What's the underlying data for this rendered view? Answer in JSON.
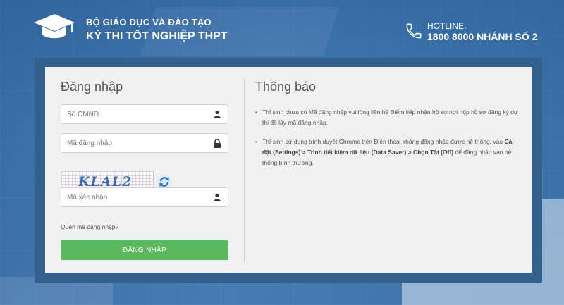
{
  "header": {
    "org": "BỘ GIÁO DỤC VÀ ĐÀO TẠO",
    "title": "KỲ THI TỐT NGHIỆP THPT",
    "hotline_label": "HOTLINE:",
    "hotline_number": "1800 8000 NHÁNH SỐ 2"
  },
  "login": {
    "title": "Đăng nhập",
    "id_placeholder": "Số CMND",
    "code_placeholder": "Mã đăng nhập",
    "captcha_text": "KLAL2",
    "captcha_placeholder": "Mã xác nhận",
    "forgot_label": "Quên mã đăng nhập?",
    "submit_label": "ĐĂNG NHẬP"
  },
  "notice": {
    "title": "Thông báo",
    "item1": "Thí sinh chưa có Mã đăng nhập vui lòng liên hệ Điểm tiếp nhận hồ sơ nơi nộp hồ sơ đăng ký dự thi để lấy mã đăng nhập.",
    "item2_pre": "Thí sinh sử dụng trình duyệt Chrome trên Điện thoại không đăng nhập được hệ thống, vào ",
    "item2_bold": "Cài đặt (Settings) > Trình tiết kiệm dữ liệu (Data Saver) > Chọn Tắt (Off)",
    "item2_post": " để đăng nhập vào hệ thống bình thường."
  },
  "colors": {
    "background": "#3f76ad",
    "submit": "#5cb85c",
    "card": "#f1f1f1"
  },
  "icons": [
    "graduation-cap-icon",
    "phone-icon",
    "user-icon",
    "lock-icon",
    "refresh-icon"
  ]
}
